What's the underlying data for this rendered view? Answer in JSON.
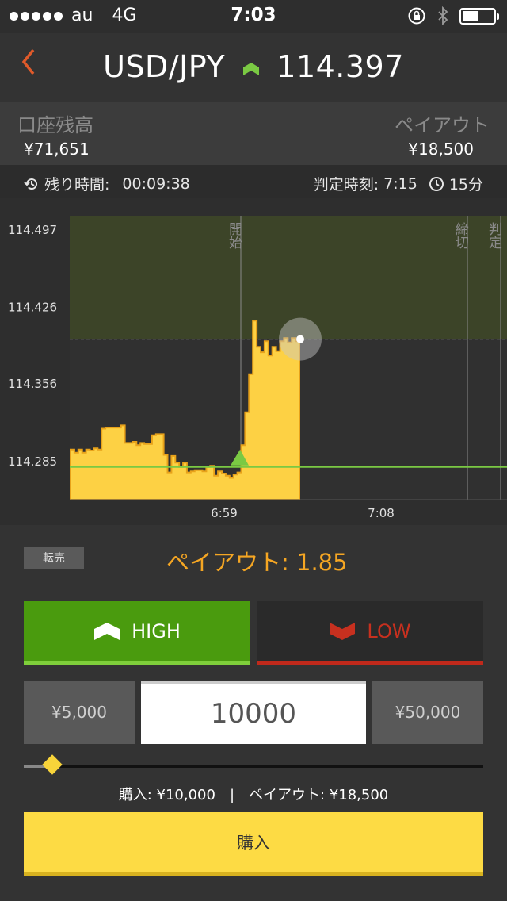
{
  "status_bar": {
    "carrier": "au",
    "network": "4G",
    "time": "7:03"
  },
  "header": {
    "back_icon": "chevron-left-icon",
    "pair": "USD/JPY",
    "trend_icon": "up-arrow-icon",
    "price": "114.397"
  },
  "account": {
    "balance_label": "口座残高",
    "balance_value": "¥71,651",
    "payout_label": "ペイアウト",
    "payout_value": "¥18,500"
  },
  "time_row": {
    "remaining_label": "残り時間:",
    "remaining_value": "00:09:38",
    "judgement_label": "判定時刻:",
    "judgement_value": "7:15",
    "duration": "15分"
  },
  "chart_data": {
    "type": "area",
    "ylim": [
      114.25,
      114.51
    ],
    "y_ticks": [
      "114.497",
      "114.426",
      "114.356",
      "114.285"
    ],
    "x_ticks": [
      "6:59",
      "7:08"
    ],
    "markers": {
      "start": "開始",
      "close": "締切",
      "judgement": "判定"
    },
    "entry_level": 114.28,
    "current_level": 114.397,
    "series": [
      {
        "values": [
          114.296,
          114.293,
          114.296,
          114.293,
          114.296,
          114.295,
          114.297,
          114.296,
          114.315,
          114.316,
          114.316,
          114.316,
          114.316,
          114.318,
          114.302,
          114.302,
          114.303,
          114.3,
          114.302,
          114.301,
          114.301,
          114.309,
          114.31,
          114.31,
          114.291,
          114.275,
          114.29,
          114.284,
          114.28,
          114.284,
          114.275,
          114.276,
          114.277,
          114.277,
          114.276,
          114.28,
          114.281,
          114.272,
          114.276,
          114.274,
          114.272,
          114.27,
          114.273,
          114.275,
          114.3,
          114.33,
          114.365,
          114.414,
          114.39,
          114.385,
          114.395,
          114.382,
          114.39,
          114.386,
          114.395,
          114.398,
          114.394,
          114.398,
          114.395,
          114.397
        ]
      }
    ]
  },
  "bottom": {
    "resell_label": "転売",
    "payout_rate_label": "ペイアウト: 1.85",
    "high_label": "HIGH",
    "low_label": "LOW",
    "amount_min": "¥5,000",
    "amount_value": "10000",
    "amount_max": "¥50,000",
    "slider_fraction": 0.06,
    "summary_buy": "購入: ¥10,000",
    "summary_sep": "|",
    "summary_payout": "ペイアウト: ¥18,500",
    "buy_label": "購入"
  },
  "colors": {
    "accent_orange": "#f5a623",
    "high_green": "#4a9b0e",
    "low_red": "#c7301f",
    "chart_fill": "#fdd144",
    "buy_yellow": "#fddb44"
  }
}
